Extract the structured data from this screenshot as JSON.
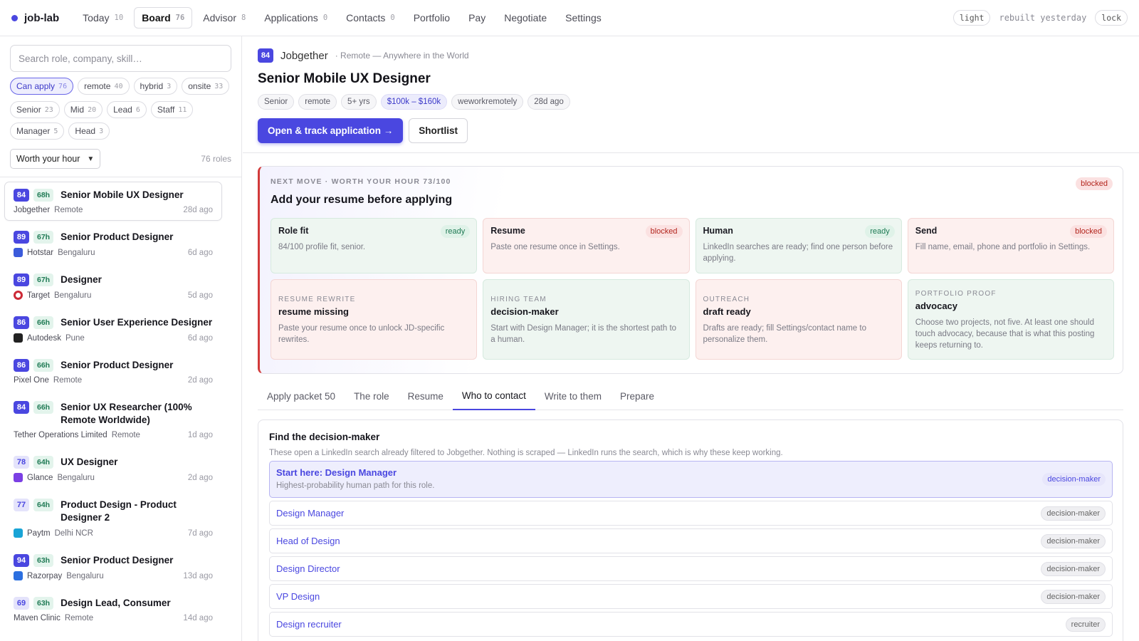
{
  "app": {
    "name": "job-lab"
  },
  "nav": [
    {
      "label": "Today",
      "count": "10"
    },
    {
      "label": "Board",
      "count": "76",
      "active": true
    },
    {
      "label": "Advisor",
      "count": "8"
    },
    {
      "label": "Applications",
      "count": "0"
    },
    {
      "label": "Contacts",
      "count": "0"
    },
    {
      "label": "Portfolio",
      "count": ""
    },
    {
      "label": "Pay",
      "count": ""
    },
    {
      "label": "Negotiate",
      "count": ""
    },
    {
      "label": "Settings",
      "count": ""
    }
  ],
  "topbar": {
    "theme": "light",
    "status": "rebuilt yesterday",
    "lock": "lock"
  },
  "sidebar": {
    "search_placeholder": "Search role, company, skill…",
    "filters_row1": [
      {
        "label": "Can apply",
        "count": "76",
        "active": true
      },
      {
        "label": "remote",
        "count": "40"
      },
      {
        "label": "hybrid",
        "count": "3"
      },
      {
        "label": "onsite",
        "count": "33"
      }
    ],
    "filters_row2": [
      {
        "label": "Senior",
        "count": "23"
      },
      {
        "label": "Mid",
        "count": "20"
      },
      {
        "label": "Lead",
        "count": "6"
      },
      {
        "label": "Staff",
        "count": "11"
      },
      {
        "label": "Manager",
        "count": "5"
      },
      {
        "label": "Head",
        "count": "3"
      }
    ],
    "sort_label": "Worth your hour",
    "roles_count": "76 roles",
    "jobs": [
      {
        "score": "84",
        "hours": "68h",
        "title": "Senior Mobile UX Designer",
        "company": "Jobgether",
        "location": "Remote",
        "age": "28d ago",
        "logo_color": "",
        "selected": true
      },
      {
        "score": "89",
        "hours": "67h",
        "title": "Senior Product Designer",
        "company": "Hotstar",
        "location": "Bengaluru",
        "age": "6d ago",
        "logo_color": "#3b5bdb"
      },
      {
        "score": "89",
        "hours": "67h",
        "title": "Designer",
        "company": "Target",
        "location": "Bengaluru",
        "age": "5d ago",
        "logo_color": "#cc2936"
      },
      {
        "score": "86",
        "hours": "66h",
        "title": "Senior User Experience Designer",
        "company": "Autodesk",
        "location": "Pune",
        "age": "6d ago",
        "logo_color": "#222222"
      },
      {
        "score": "86",
        "hours": "66h",
        "title": "Senior Product Designer",
        "company": "Pixel One",
        "location": "Remote",
        "age": "2d ago",
        "logo_color": ""
      },
      {
        "score": "84",
        "hours": "66h",
        "title": "Senior UX Researcher (100% Remote Worldwide)",
        "company": "Tether Operations Limited",
        "location": "Remote",
        "age": "1d ago",
        "logo_color": ""
      },
      {
        "score": "78",
        "hours": "64h",
        "title": "UX Designer",
        "company": "Glance",
        "location": "Bengaluru",
        "age": "2d ago",
        "logo_color": "#7b3fe4"
      },
      {
        "score": "77",
        "hours": "64h",
        "title": "Product Design - Product Designer 2",
        "company": "Paytm",
        "location": "Delhi NCR",
        "age": "7d ago",
        "logo_color": "#19a4d6"
      },
      {
        "score": "94",
        "hours": "63h",
        "title": "Senior Product Designer",
        "company": "Razorpay",
        "location": "Bengaluru",
        "age": "13d ago",
        "logo_color": "#2b6fe0"
      },
      {
        "score": "69",
        "hours": "63h",
        "title": "Design Lead, Consumer",
        "company": "Maven Clinic",
        "location": "Remote",
        "age": "14d ago",
        "logo_color": ""
      }
    ]
  },
  "job": {
    "score": "84",
    "company": "Jobgether",
    "location_line": "· Remote — Anywhere in the World",
    "title": "Senior Mobile UX Designer",
    "tags": [
      "Senior",
      "remote",
      "5+ yrs",
      "$100k – $160k",
      "weworkremotely",
      "28d ago"
    ],
    "primary_action": "Open & track application →",
    "secondary_action": "Shortlist"
  },
  "next_move": {
    "eyebrow": "NEXT MOVE · WORTH YOUR HOUR 73/100",
    "title": "Add your resume before applying",
    "status": "blocked",
    "gates": [
      {
        "name": "Role fit",
        "status": "ready",
        "desc": "84/100 profile fit, senior."
      },
      {
        "name": "Resume",
        "status": "blocked",
        "desc": "Paste one resume once in Settings."
      },
      {
        "name": "Human",
        "status": "ready",
        "desc": "LinkedIn searches are ready; find one person before applying."
      },
      {
        "name": "Send",
        "status": "blocked",
        "desc": "Fill name, email, phone and portfolio in Settings."
      }
    ],
    "details": [
      {
        "eyebrow": "RESUME REWRITE",
        "title": "resume missing",
        "desc": "Paste your resume once to unlock JD-specific rewrites.",
        "tone": "bad"
      },
      {
        "eyebrow": "HIRING TEAM",
        "title": "decision-maker",
        "desc": "Start with Design Manager; it is the shortest path to a human.",
        "tone": "ok"
      },
      {
        "eyebrow": "OUTREACH",
        "title": "draft ready",
        "desc": "Drafts are ready; fill Settings/contact name to personalize them.",
        "tone": "bad"
      },
      {
        "eyebrow": "PORTFOLIO PROOF",
        "title": "advocacy",
        "desc": "Choose two projects, not five. At least one should touch advocacy, because that is what this posting keeps returning to.",
        "tone": "ok"
      }
    ]
  },
  "tabs": [
    {
      "label": "Apply packet 50"
    },
    {
      "label": "The role"
    },
    {
      "label": "Resume"
    },
    {
      "label": "Who to contact",
      "active": true
    },
    {
      "label": "Write to them"
    },
    {
      "label": "Prepare"
    }
  ],
  "contacts": {
    "title": "Find the decision-maker",
    "subtitle": "These open a LinkedIn search already filtered to Jobgether. Nothing is scraped — LinkedIn runs the search, which is why these keep working.",
    "featured": {
      "label": "Start here: Design Manager",
      "hint": "Highest-probability human path for this role.",
      "badge": "decision-maker"
    },
    "items": [
      {
        "label": "Design Manager",
        "badge": "decision-maker"
      },
      {
        "label": "Head of Design",
        "badge": "decision-maker"
      },
      {
        "label": "Design Director",
        "badge": "decision-maker"
      },
      {
        "label": "VP Design",
        "badge": "decision-maker"
      },
      {
        "label": "Design recruiter",
        "badge": "recruiter"
      }
    ]
  },
  "colors": {
    "accent": "#4a47e0",
    "blocked": "#b3261e",
    "ready": "#1f7a54"
  }
}
